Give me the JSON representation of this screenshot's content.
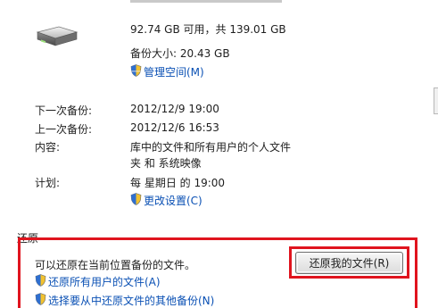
{
  "disk": {
    "space_line": "92.74 GB 可用，共 139.01 GB",
    "backup_size": "备份大小: 20.43 GB",
    "manage_space_link": "管理空间(M)"
  },
  "details": {
    "next_backup_label": "下一次备份:",
    "next_backup_value": "2012/12/9 19:00",
    "last_backup_label": "上一次备份:",
    "last_backup_value": "2012/12/6 16:53",
    "content_label": "内容:",
    "content_value_line1": "库中的文件和所有用户的个人文件",
    "content_value_line2": "夹 和 系统映像",
    "schedule_label": "计划:",
    "schedule_value": "每 星期日 的 19:00",
    "change_settings_link": "更改设置(C)"
  },
  "restore": {
    "heading": "还原",
    "description": "可以还原在当前位置备份的文件。",
    "restore_my_files_button": "还原我的文件(R)",
    "restore_all_users_link": "还原所有用户的文件(A)",
    "select_other_backup_link": "选择要从中还原文件的其他备份(N)"
  },
  "colors": {
    "link": "#0a50b4",
    "highlight_border": "#e0141e",
    "text": "#1e1e1e"
  }
}
